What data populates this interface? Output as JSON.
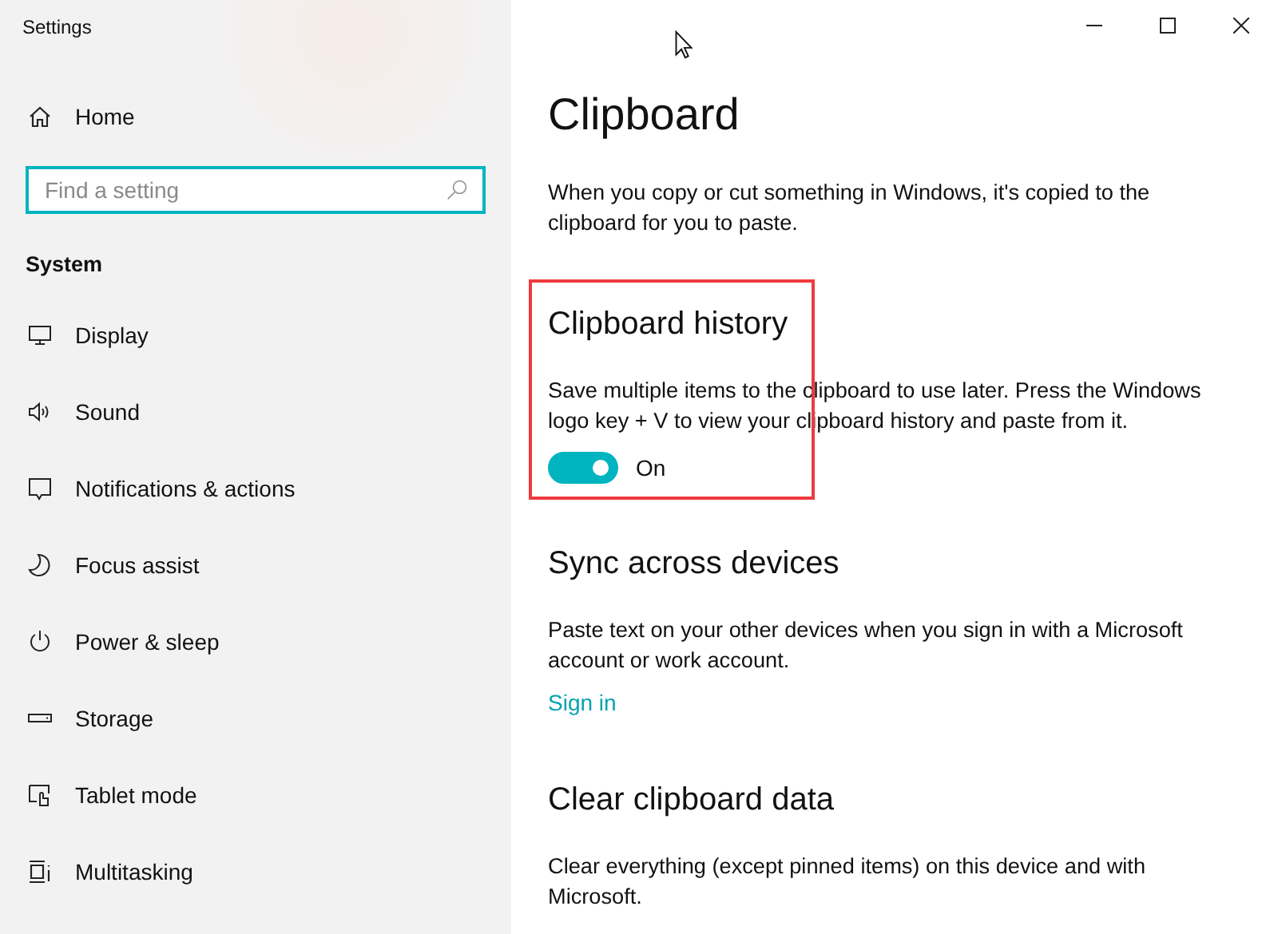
{
  "window": {
    "title": "Settings"
  },
  "sidebar": {
    "home": "Home",
    "search": {
      "placeholder": "Find a setting"
    },
    "section": "System",
    "items": [
      {
        "label": "Display"
      },
      {
        "label": "Sound"
      },
      {
        "label": "Notifications & actions"
      },
      {
        "label": "Focus assist"
      },
      {
        "label": "Power & sleep"
      },
      {
        "label": "Storage"
      },
      {
        "label": "Tablet mode"
      },
      {
        "label": "Multitasking"
      }
    ]
  },
  "main": {
    "title": "Clipboard",
    "description": "When you copy or cut something in Windows, it's copied to the clipboard for you to paste.",
    "sections": [
      {
        "kind": "toggle",
        "heading": "Clipboard history",
        "description": "Save multiple items to the clipboard to use later. Press the Windows logo key + V to view your clipboard history and paste from it.",
        "on": true,
        "state_label": "On",
        "highlighted": true
      },
      {
        "kind": "link",
        "heading": "Sync across devices",
        "description": "Paste text on your other devices when you sign in with a Microsoft account or work account.",
        "link": "Sign in",
        "highlighted": false
      },
      {
        "kind": "text",
        "heading": "Clear clipboard data",
        "description": "Clear everything (except pinned items) on this device and with Microsoft.",
        "highlighted": false
      }
    ]
  }
}
